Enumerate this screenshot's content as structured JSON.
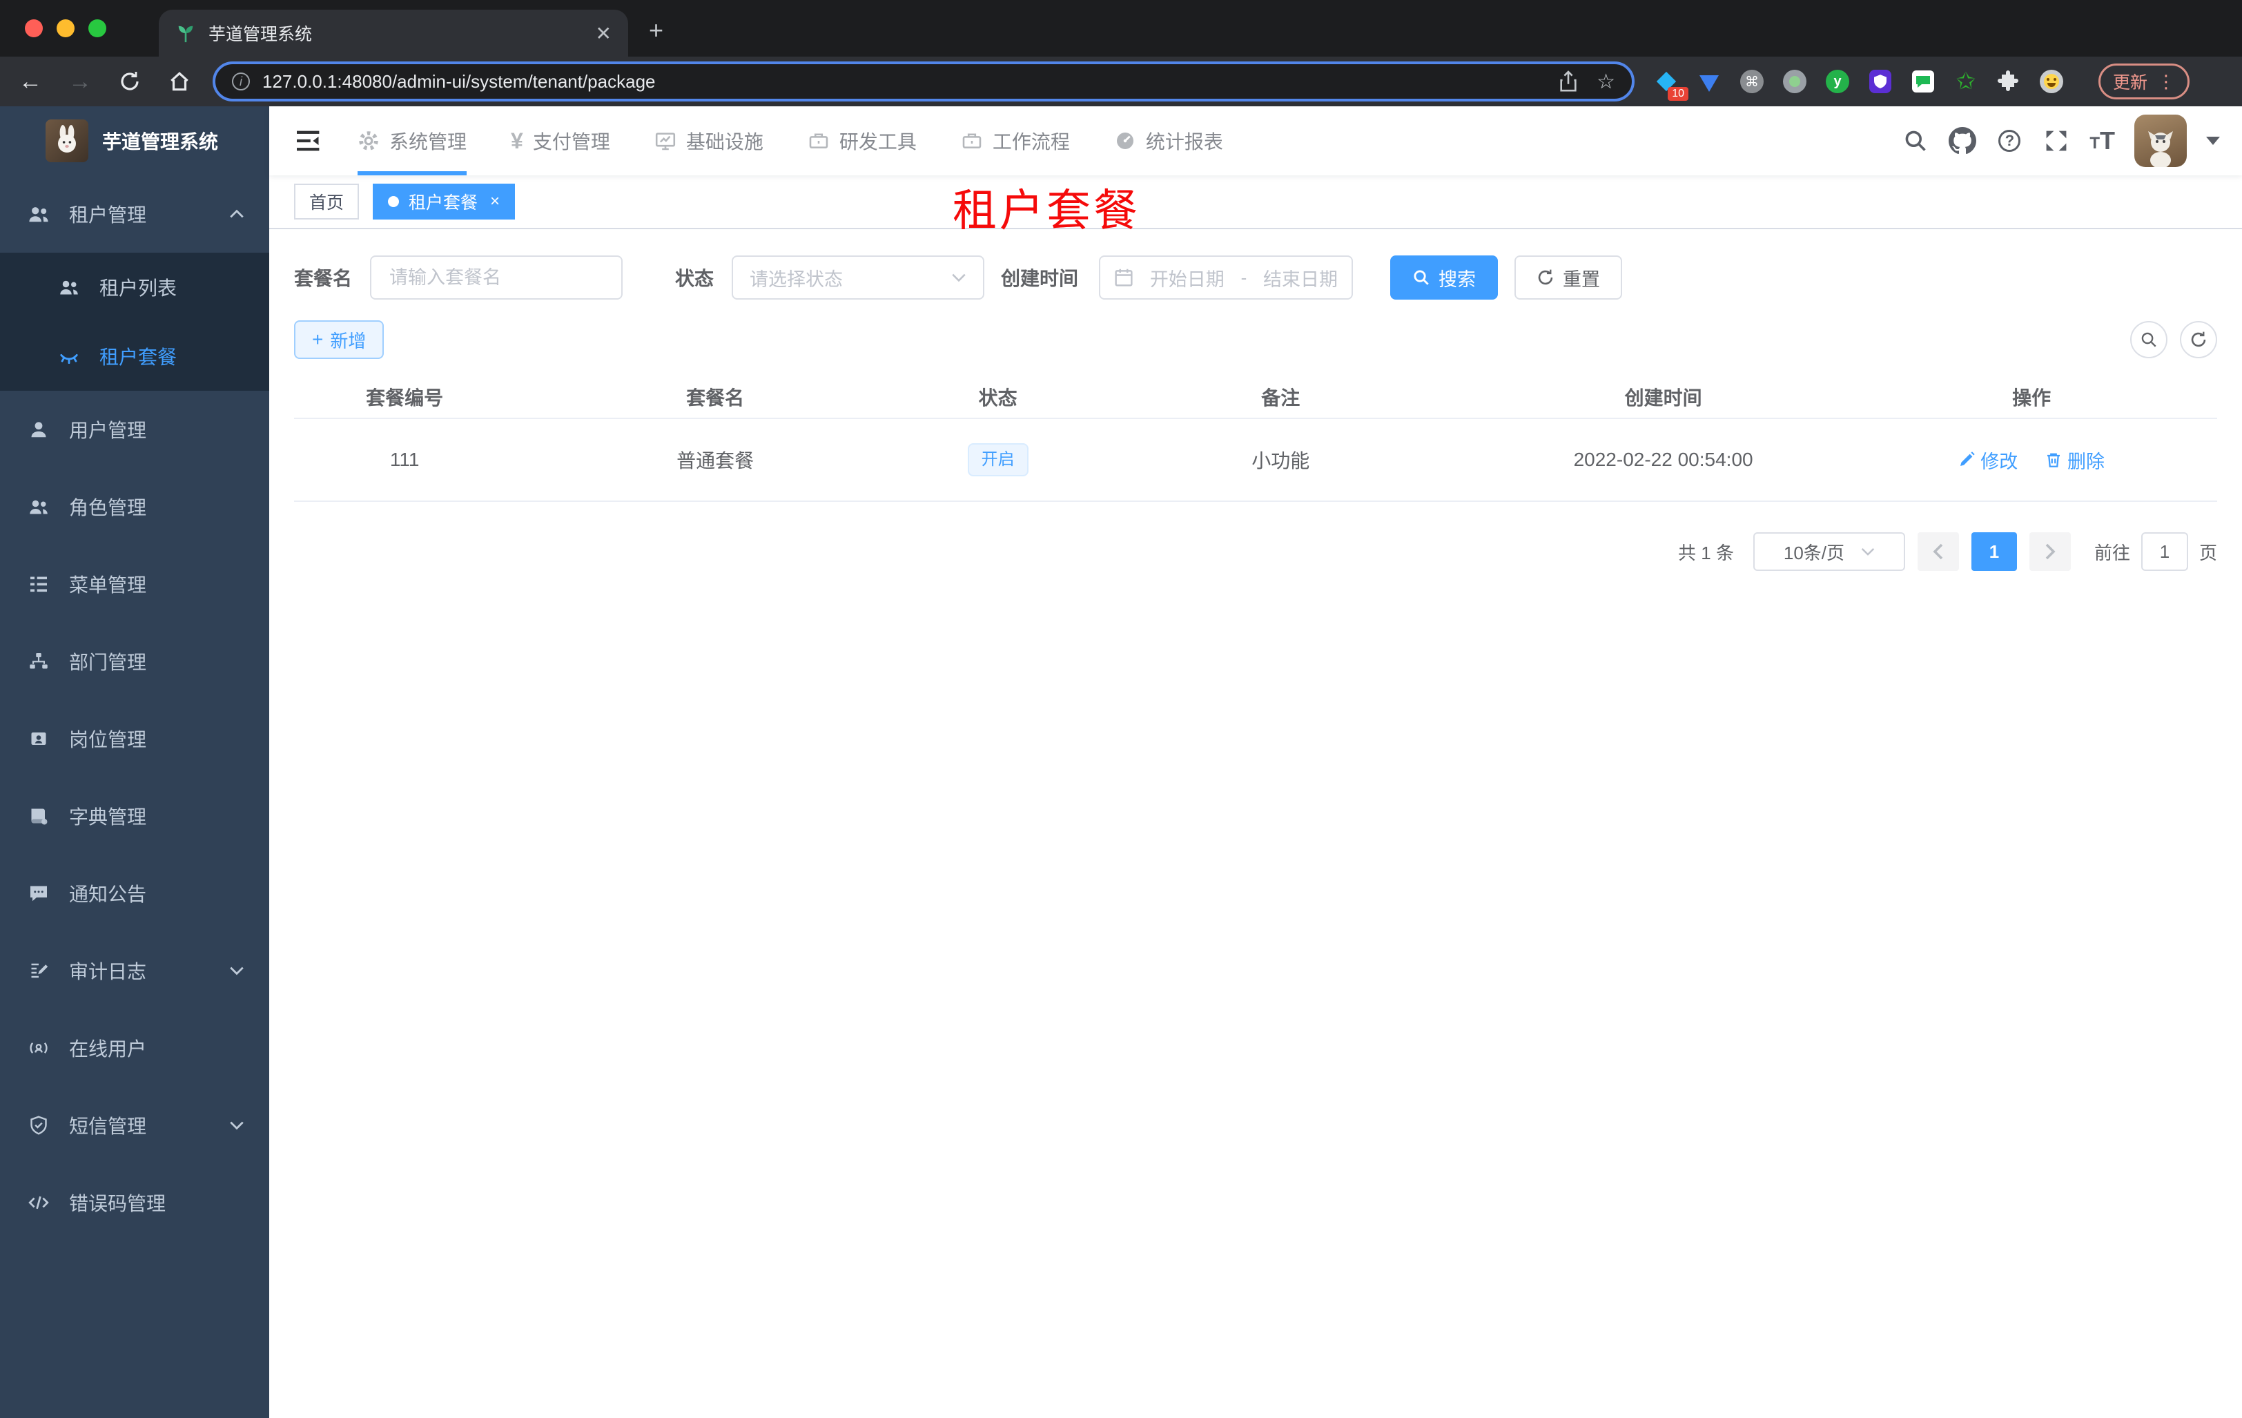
{
  "browser": {
    "tab_title": "芋道管理系统",
    "url": "127.0.0.1:48080/admin-ui/system/tenant/package",
    "extension_badge": "10",
    "update_button": "更新"
  },
  "nav": {
    "items": [
      {
        "label": "系统管理"
      },
      {
        "label": "支付管理"
      },
      {
        "label": "基础设施"
      },
      {
        "label": "研发工具"
      },
      {
        "label": "工作流程"
      },
      {
        "label": "统计报表"
      }
    ]
  },
  "sidebar": {
    "logo_title": "芋道管理系统",
    "items": [
      {
        "label": "租户管理"
      },
      {
        "label": "租户列表"
      },
      {
        "label": "租户套餐"
      },
      {
        "label": "用户管理"
      },
      {
        "label": "角色管理"
      },
      {
        "label": "菜单管理"
      },
      {
        "label": "部门管理"
      },
      {
        "label": "岗位管理"
      },
      {
        "label": "字典管理"
      },
      {
        "label": "通知公告"
      },
      {
        "label": "审计日志"
      },
      {
        "label": "在线用户"
      },
      {
        "label": "短信管理"
      },
      {
        "label": "错误码管理"
      }
    ]
  },
  "tags": {
    "home": "首页",
    "active": "租户套餐"
  },
  "page": {
    "title": "租户套餐",
    "filters": {
      "name_label": "套餐名",
      "name_placeholder": "请输入套餐名",
      "status_label": "状态",
      "status_placeholder": "请选择状态",
      "date_label": "创建时间",
      "date_start": "开始日期",
      "date_separator": "-",
      "date_end": "结束日期",
      "search": "搜索",
      "reset": "重置"
    },
    "toolbar": {
      "add": "新增"
    },
    "table": {
      "headers": [
        "套餐编号",
        "套餐名",
        "状态",
        "备注",
        "创建时间",
        "操作"
      ],
      "rows": [
        {
          "id": "111",
          "name": "普通套餐",
          "status": "开启",
          "remark": "小功能",
          "created_at": "2022-02-22 00:54:00",
          "actions": {
            "edit": "修改",
            "delete": "删除"
          }
        }
      ]
    },
    "pagination": {
      "total": "共 1 条",
      "page_size": "10条/页",
      "current_page": "1",
      "goto_label": "前往",
      "goto_value": "1",
      "page_unit": "页"
    }
  },
  "colors": {
    "primary": "#409eff",
    "sidebar_bg": "#304156",
    "submenu_bg": "#1f2d3d",
    "title_red": "#ff0000"
  }
}
